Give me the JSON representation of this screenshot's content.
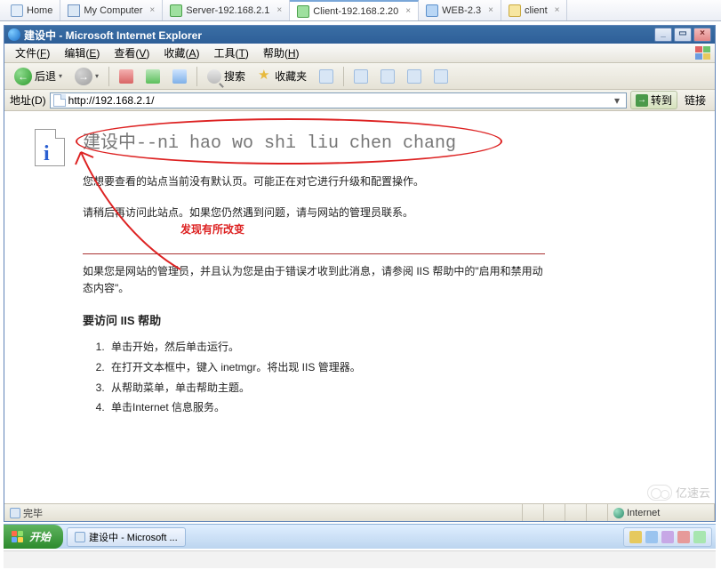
{
  "vmtabs": [
    {
      "label": "Home",
      "icon": "ico-home",
      "closable": false,
      "active": false
    },
    {
      "label": "My Computer",
      "icon": "ico-pc",
      "closable": true,
      "active": false
    },
    {
      "label": "Server-192.168.2.1",
      "icon": "ico-vm-g",
      "closable": true,
      "active": false
    },
    {
      "label": "Client-192.168.2.20",
      "icon": "ico-vm-g",
      "closable": true,
      "active": true
    },
    {
      "label": "WEB-2.3",
      "icon": "ico-vm-b",
      "closable": true,
      "active": false
    },
    {
      "label": "client",
      "icon": "ico-folder",
      "closable": true,
      "active": false
    }
  ],
  "ie": {
    "title": "建设中 - Microsoft Internet Explorer",
    "menu": {
      "file": {
        "label": "文件",
        "key": "F"
      },
      "edit": {
        "label": "编辑",
        "key": "E"
      },
      "view": {
        "label": "查看",
        "key": "V"
      },
      "fav": {
        "label": "收藏",
        "key": "A"
      },
      "tools": {
        "label": "工具",
        "key": "T"
      },
      "help": {
        "label": "帮助",
        "key": "H"
      }
    },
    "toolbar": {
      "back": "后退",
      "search": "搜索",
      "favorites": "收藏夹"
    },
    "address": {
      "label": "地址(D)",
      "url": "http://192.168.2.1/",
      "go": "转到",
      "links": "链接"
    },
    "status": {
      "done": "完毕",
      "zone": "Internet"
    }
  },
  "page": {
    "h1": "建设中--ni hao wo shi liu chen chang",
    "p1": "您想要查看的站点当前没有默认页。可能正在对它进行升级和配置操作。",
    "p2a": "请稍后再访问此站点。如果您仍然遇到问题，请与网站的管理员联系。",
    "annotation": "发现有所改变",
    "p3": "如果您是网站的管理员，并且认为您是由于错误才收到此消息，请参阅 IIS 帮助中的\"启用和禁用动态内容\"。",
    "h2": "要访问 IIS 帮助",
    "steps": [
      "单击开始，然后单击运行。",
      "在打开文本框中，键入 inetmgr。将出现 IIS 管理器。",
      "从帮助菜单，单击帮助主题。",
      "单击Internet 信息服务。"
    ]
  },
  "taskbar": {
    "start": "开始",
    "task1": "建设中 - Microsoft ..."
  },
  "watermark": "亿速云"
}
